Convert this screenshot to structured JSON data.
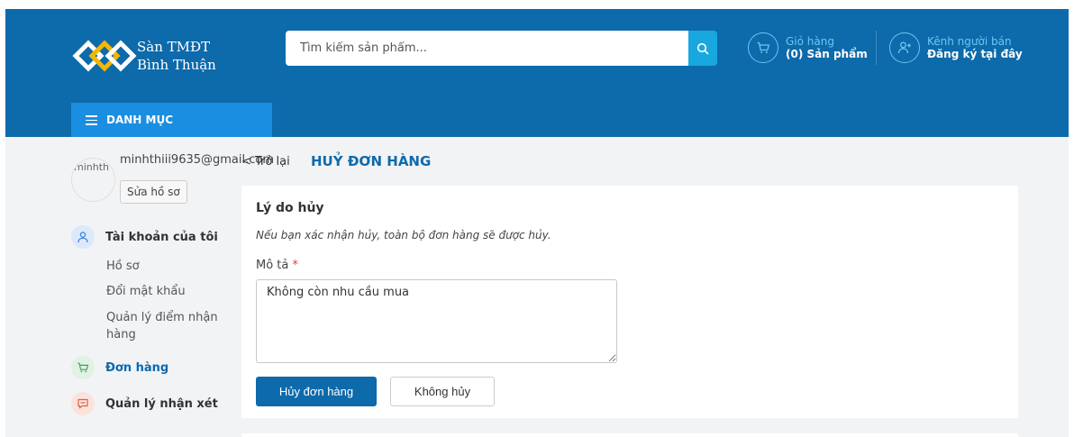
{
  "colors": {
    "brand": "#0d6aab",
    "accent": "#1a8ee0",
    "search_button": "#19a7e0",
    "required": "#e53935"
  },
  "header": {
    "logo_line1": "Sàn TMĐT",
    "logo_line2": "Bình Thuận",
    "search_placeholder": "Tìm kiếm sản phẩm...",
    "cart_top": "Giỏ hàng",
    "cart_bottom": "(0) Sản phẩm",
    "seller_top": "Kênh người bán",
    "seller_bottom": "Đăng ký tại đây",
    "menu_label": "DANH MỤC",
    "icons": {
      "search": "search-icon",
      "cart": "cart-icon",
      "seller": "user-plus-icon",
      "menu": "hamburger-icon"
    }
  },
  "sidebar": {
    "avatar_alt": "minhth",
    "email": "minhthiii9635@gmail.com",
    "edit_profile": "Sửa hồ sơ",
    "account": "Tài khoản của tôi",
    "sub_items": [
      "Hồ sơ",
      "Đổi mật khẩu",
      "Quản lý điểm nhận hàng"
    ],
    "orders": "Đơn hàng",
    "reviews": "Quản lý nhận xét",
    "icons": {
      "account": "user-icon",
      "orders": "cart-icon",
      "reviews": "comment-icon"
    }
  },
  "main": {
    "back": "< Trở lại",
    "title": "HUỶ ĐƠN HÀNG",
    "card_title": "Lý do hủy",
    "note": "Nếu bạn xác nhận hủy, toàn bộ đơn hàng sẽ được hủy.",
    "field_label": "Mô tả",
    "required_mark": "*",
    "description_value": "Không còn nhu cầu mua",
    "confirm_button": "Hủy đơn hàng",
    "dismiss_button": "Không hủy"
  }
}
